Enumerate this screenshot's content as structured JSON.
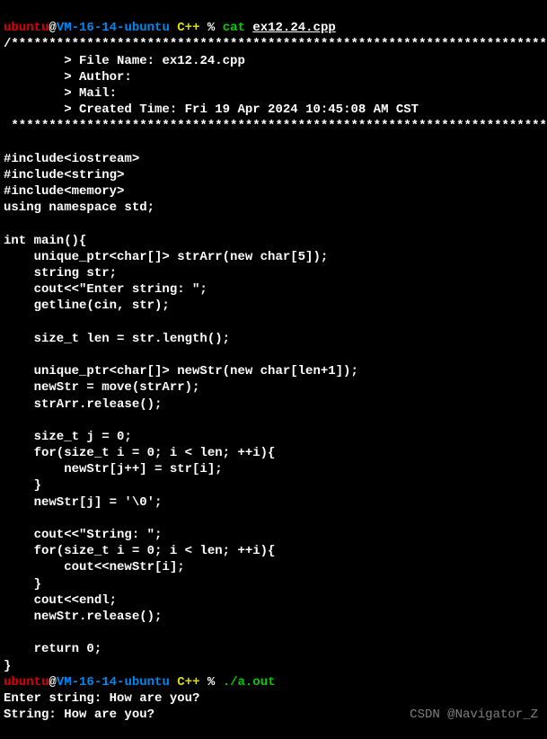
{
  "prompt1": {
    "user": "ubuntu",
    "at": "@",
    "host": "VM-16-14-ubuntu",
    "dir": "C++",
    "sep": " % ",
    "cmd": "cat",
    "arg": "ex12.24.cpp"
  },
  "header": {
    "line1": "/*************************************************************************",
    "file_label": "        > File Name: ",
    "file_value": "ex12.24.cpp",
    "author_label": "        > Author: ",
    "mail_label": "        > Mail: ",
    "time_label": "        > Created Time: ",
    "time_value": "Fri 19 Apr 2024 10:45:08 AM CST",
    "line_end": " ************************************************************************/"
  },
  "code": {
    "l1": "#include<iostream>",
    "l2": "#include<string>",
    "l3": "#include<memory>",
    "l4": "using namespace std;",
    "l5": "",
    "l6": "int main(){",
    "l7": "    unique_ptr<char[]> strArr(new char[5]);",
    "l8": "    string str;",
    "l9": "    cout<<\"Enter string: \";",
    "l10": "    getline(cin, str);",
    "l11": "",
    "l12": "    size_t len = str.length();",
    "l13": "",
    "l14": "    unique_ptr<char[]> newStr(new char[len+1]);",
    "l15": "    newStr = move(strArr);",
    "l16": "    strArr.release();",
    "l17": "",
    "l18": "    size_t j = 0;",
    "l19": "    for(size_t i = 0; i < len; ++i){",
    "l20": "        newStr[j++] = str[i];",
    "l21": "    }",
    "l22": "    newStr[j] = '\\0';",
    "l23": "",
    "l24": "    cout<<\"String: \";",
    "l25": "    for(size_t i = 0; i < len; ++i){",
    "l26": "        cout<<newStr[i];",
    "l27": "    }",
    "l28": "    cout<<endl;",
    "l29": "    newStr.release();",
    "l30": "",
    "l31": "    return 0;",
    "l32": "}"
  },
  "prompt2": {
    "user": "ubuntu",
    "at": "@",
    "host": "VM-16-14-ubuntu",
    "dir": "C++",
    "sep": " % ",
    "cmd": "./a.out"
  },
  "output": {
    "l1": "Enter string: How are you?",
    "l2": "String: How are you?"
  },
  "watermark": "CSDN @Navigator_Z"
}
